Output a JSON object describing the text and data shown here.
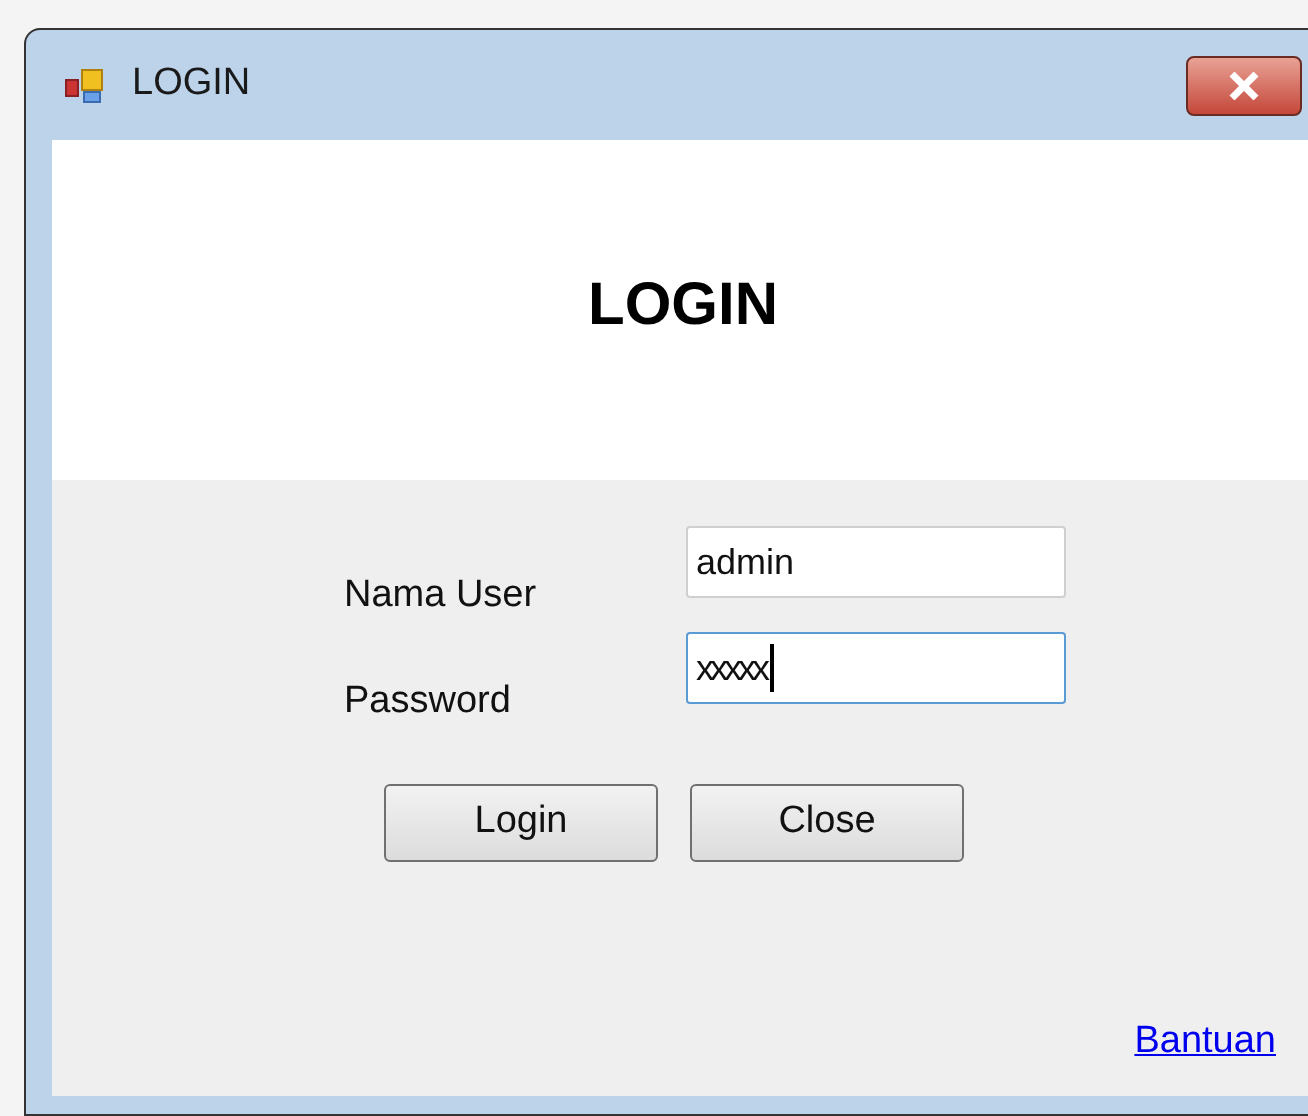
{
  "window": {
    "title": "LOGIN"
  },
  "header": {
    "title": "LOGIN"
  },
  "fields": [
    {
      "label": "Nama User",
      "value": "admin",
      "focused": false
    },
    {
      "label": "Password",
      "value": "xxxxx",
      "focused": true
    }
  ],
  "buttons": [
    "Login",
    "Close"
  ],
  "link": "Bantuan"
}
